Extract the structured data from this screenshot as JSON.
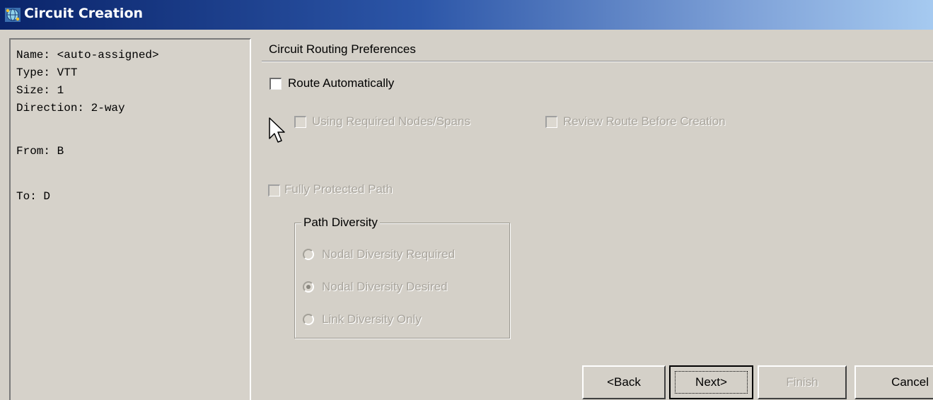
{
  "window": {
    "title": "Circuit Creation",
    "icon": "network-globe-icon"
  },
  "summary": {
    "name": "Name: <auto-assigned>",
    "type": "Type: VTT",
    "size": "Size: 1",
    "direction": "Direction: 2-way",
    "from": "From: B",
    "to": "To: D"
  },
  "routing": {
    "header": "Circuit Routing Preferences",
    "route_automatically": {
      "label": "Route Automatically",
      "checked": false
    },
    "using_required": {
      "label": "Using Required Nodes/Spans",
      "checked": false,
      "enabled": false
    },
    "review_route": {
      "label": "Review Route Before Creation",
      "checked": false,
      "enabled": false
    },
    "fully_protected": {
      "label": "Fully Protected Path",
      "checked": false,
      "enabled": false
    }
  },
  "path_diversity": {
    "title": "Path Diversity",
    "options": [
      {
        "label": "Nodal Diversity Required",
        "selected": false
      },
      {
        "label": "Nodal Diversity Desired",
        "selected": true
      },
      {
        "label": "Link Diversity Only",
        "selected": false
      }
    ]
  },
  "buttons": {
    "back": "<Back",
    "next": "Next>",
    "finish": "Finish",
    "cancel": "Cancel"
  }
}
